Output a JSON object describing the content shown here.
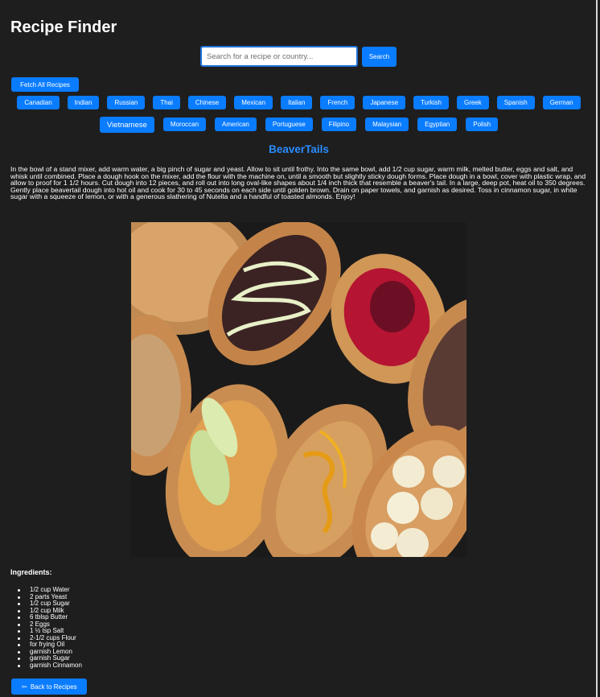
{
  "app": {
    "title": "Recipe Finder"
  },
  "search": {
    "placeholder": "Search for a recipe or country...",
    "value": "",
    "button_label": "Search"
  },
  "fetch_all_label": "Fetch All Recipes",
  "cuisines_row1": [
    "Canadian",
    "Indian",
    "Russian",
    "Thai",
    "Chinese",
    "Mexican",
    "Italian",
    "French",
    "Japanese",
    "Turkish",
    "Greek",
    "Spanish",
    "German"
  ],
  "cuisines_row2": [
    "Vietnamese",
    "Moroccan",
    "American",
    "Portuguese",
    "Filipino",
    "Malaysian",
    "Egyptian",
    "Polish"
  ],
  "active_cuisine": "Vietnamese",
  "recipe": {
    "title": "BeaverTails",
    "instructions": "In the bowl of a stand mixer, add warm water, a big pinch of sugar and yeast. Allow to sit until frothy. Into the same bowl, add 1/2 cup sugar, warm milk, melted butter, eggs and salt, and whisk until combined. Place a dough hook on the mixer, add the flour with the machine on, until a smooth but slightly sticky dough forms. Place dough in a bowl, cover with plastic wrap, and allow to proof for 1 1/2 hours. Cut dough into 12 pieces, and roll out into long oval-like shapes about 1/4 inch thick that resemble a beaver's tail. In a large, deep pot, heat oil to 350 degrees. Gently place beavertail dough into hot oil and cook for 30 to 45 seconds on each side until golden brown. Drain on paper towels, and garnish as desired. Toss in cinnamon sugar, in white sugar with a squeeze of lemon, or with a generous slathering of Nutella and a handful of toasted almonds. Enjoy!",
    "ingredients_heading": "Ingredients:",
    "ingredients": [
      "1/2 cup Water",
      "2 parts Yeast",
      "1/2 cup Sugar",
      "1/2 cup Milk",
      "6 tblsp Butter",
      "2 Eggs",
      "1 ½ tsp Salt",
      "2-1/2 cups Flour",
      "for frying Oil",
      "garnish Lemon",
      "garnish Sugar",
      "garnish Cinnamon"
    ]
  },
  "back_label": "Back to Recipes",
  "colors": {
    "accent": "#0a7cff",
    "title_blue": "#2a8cff",
    "background": "#1e1e1e"
  },
  "icons": {
    "back": "back-arrow-icon"
  }
}
